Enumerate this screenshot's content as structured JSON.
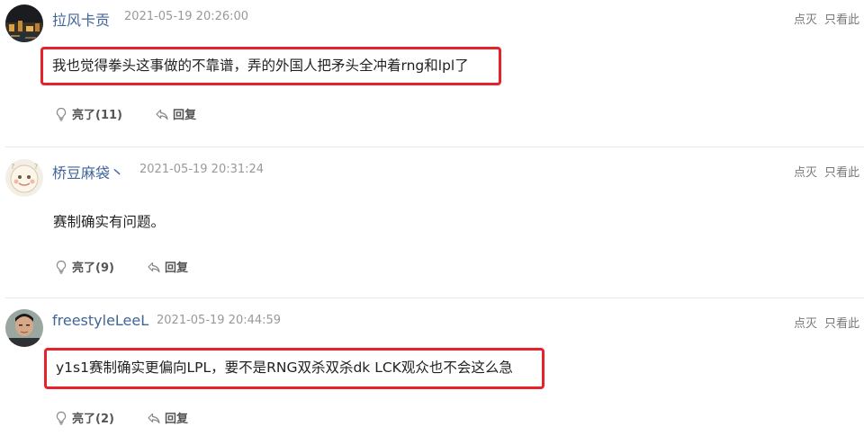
{
  "comments": [
    {
      "username": "拉风卡贡",
      "timestamp": "2021-05-19 20:26:00",
      "content": "我也觉得拳头这事做的不靠谱，弄的外国人把矛头全冲着rng和lpl了",
      "likes_label": "亮了(11)",
      "reply_label": "回复",
      "dismiss_label": "点灭",
      "only_label": "只看此"
    },
    {
      "username": "桥豆麻袋丶",
      "timestamp": "2021-05-19 20:31:24",
      "content": "赛制确实有问题。",
      "likes_label": "亮了(9)",
      "reply_label": "回复",
      "dismiss_label": "点灭",
      "only_label": "只看此"
    },
    {
      "username": "freestyleLeeL",
      "timestamp": "2021-05-19 20:44:59",
      "content": "y1s1赛制确实更偏向LPL，要不是RNG双杀双杀dk LCK观众也不会这么急",
      "likes_label": "亮了(2)",
      "reply_label": "回复",
      "dismiss_label": "点灭",
      "only_label": "只看此"
    }
  ],
  "colors": {
    "username": "#406599",
    "highlight_border": "#e8222a",
    "timestamp": "#999999"
  },
  "icons": [
    "lightbulb-icon",
    "reply-arrow-icon"
  ]
}
